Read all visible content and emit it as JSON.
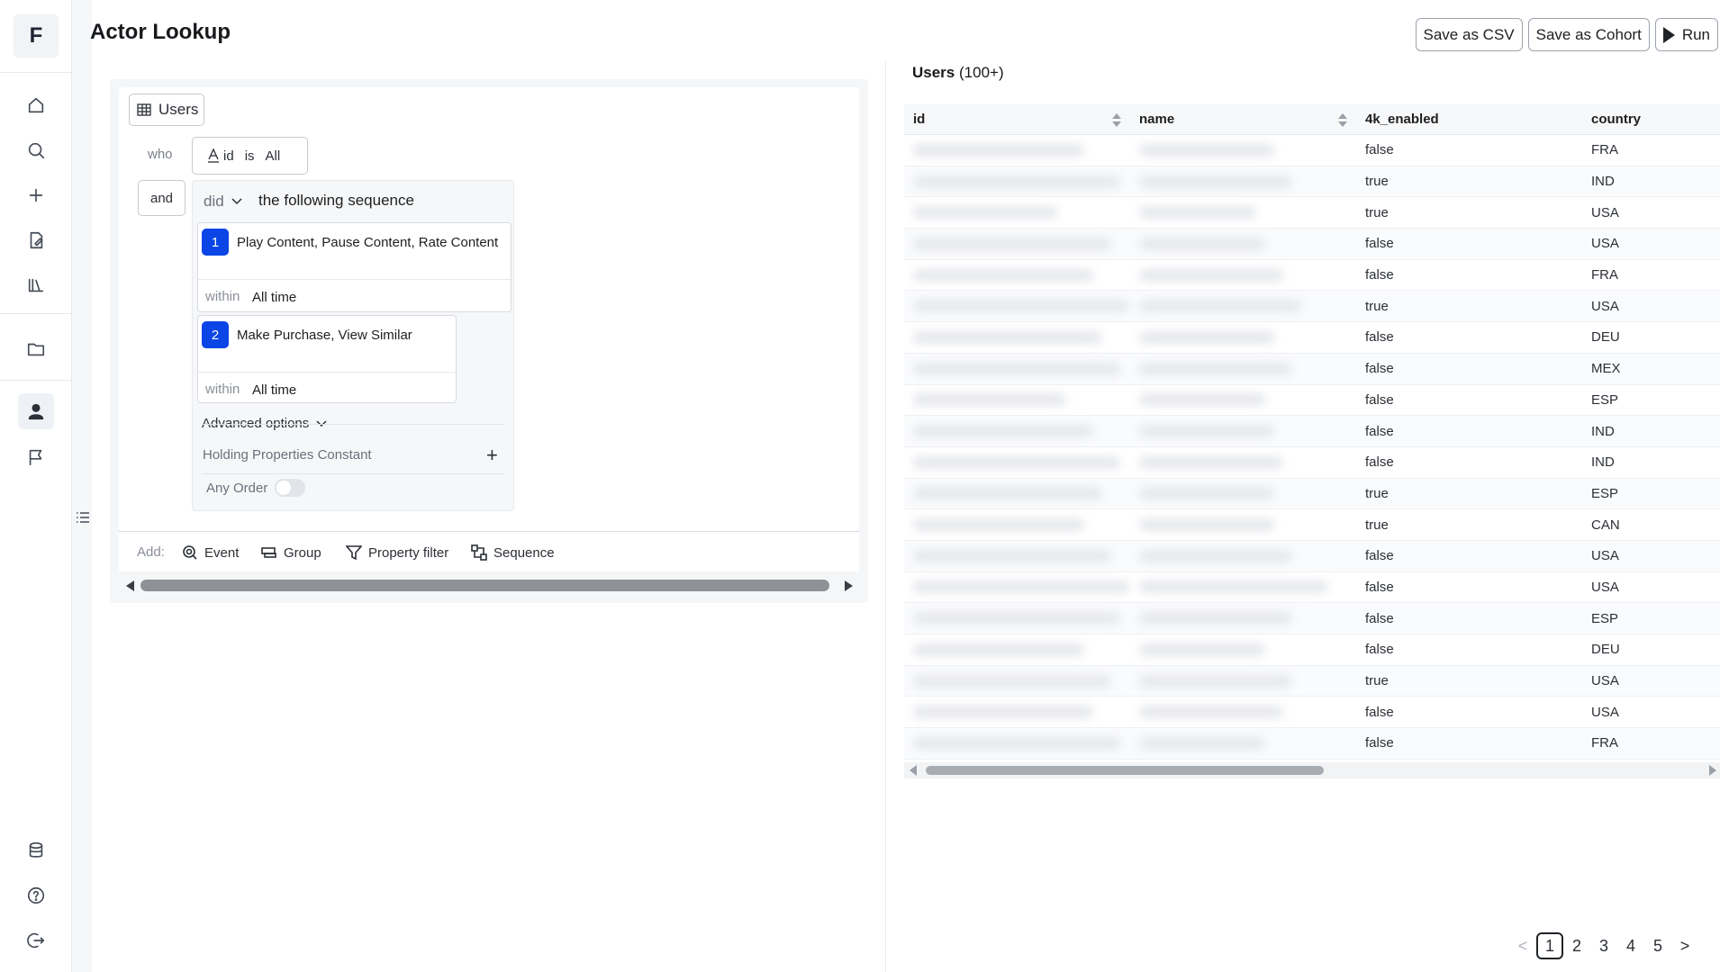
{
  "app": {
    "logo_letter": "F",
    "page_title": "Actor Lookup"
  },
  "toolbar": {
    "save_csv_label": "Save as CSV",
    "save_cohort_label": "Save as Cohort",
    "run_label": "Run"
  },
  "builder": {
    "source_label": "Users",
    "who_label": "who",
    "condition": {
      "field": "id",
      "operator": "is",
      "value": "All"
    },
    "and_label": "and",
    "did_label": "did",
    "sequence_label": "the following sequence",
    "steps": [
      {
        "number": "1",
        "events": "Play Content, Pause Content, Rate Content",
        "within_label": "within",
        "within_value": "All time"
      },
      {
        "number": "2",
        "events": "Make Purchase, View Similar",
        "within_label": "within",
        "within_value": "All time"
      }
    ],
    "advanced_label": "Advanced options",
    "holding_label": "Holding Properties Constant",
    "any_order_label": "Any Order",
    "any_order_enabled": false,
    "add_label": "Add:",
    "add_items": [
      "Event",
      "Group",
      "Property filter",
      "Sequence"
    ]
  },
  "results": {
    "title": "Users",
    "count": "(100+)",
    "columns": [
      "id",
      "name",
      "4k_enabled",
      "country"
    ],
    "rows": [
      [
        "false",
        "FRA"
      ],
      [
        "true",
        "IND"
      ],
      [
        "true",
        "USA"
      ],
      [
        "false",
        "USA"
      ],
      [
        "false",
        "FRA"
      ],
      [
        "true",
        "USA"
      ],
      [
        "false",
        "DEU"
      ],
      [
        "false",
        "MEX"
      ],
      [
        "false",
        "ESP"
      ],
      [
        "false",
        "IND"
      ],
      [
        "false",
        "IND"
      ],
      [
        "true",
        "ESP"
      ],
      [
        "true",
        "CAN"
      ],
      [
        "false",
        "USA"
      ],
      [
        "false",
        "USA"
      ],
      [
        "false",
        "ESP"
      ],
      [
        "false",
        "DEU"
      ],
      [
        "true",
        "USA"
      ],
      [
        "false",
        "USA"
      ],
      [
        "false",
        "FRA"
      ]
    ]
  },
  "pagination": {
    "prev": "<",
    "pages": [
      "1",
      "2",
      "3",
      "4",
      "5"
    ],
    "current": "1",
    "next": ">"
  }
}
